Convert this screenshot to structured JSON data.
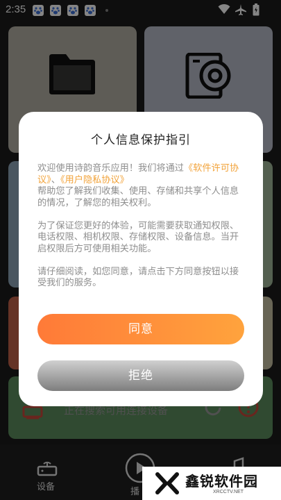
{
  "status_bar": {
    "time": "2:35"
  },
  "background": {
    "scan_text": "正在搜索可用连接设备",
    "nav": {
      "devices_label": "设备",
      "play_label": "播"
    }
  },
  "dialog": {
    "title": "个人信息保护指引",
    "intro_prefix": "欢迎使用诗韵音乐应用！我们将通过",
    "license_link": "《软件许可协议》",
    "separator": "、",
    "privacy_link": "《用户隐私协议》",
    "intro_suffix": "帮助您了解我们收集、使用、存储和共享个人信息的情况，了解您的相关权利。",
    "paragraph2": "为了保证您更好的体验，可能需要获取通知权限、电话权限、相机权限、存储权限、设备信息。当开启权限后方可使用相关功能。",
    "paragraph3": "请仔细阅读，如您同意，请点击下方同意按钮以接受我们的服务。",
    "agree_label": "同意",
    "reject_label": "拒绝"
  },
  "watermark": {
    "name": "鑫锐软件园",
    "url": "XRCCTV.NET"
  },
  "colors": {
    "link": "#f2a33a",
    "agree_start": "#ff7a38",
    "agree_end": "#ffa33d"
  }
}
